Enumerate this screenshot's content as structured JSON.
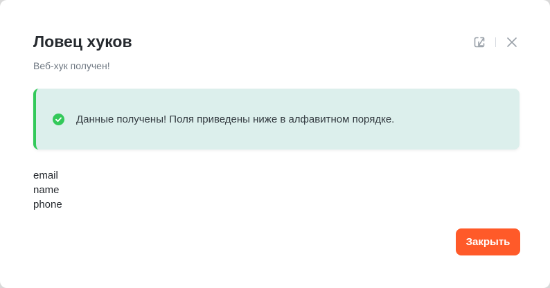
{
  "modal": {
    "title": "Ловец хуков",
    "subtitle": "Веб-хук получен!",
    "header_icons": [
      "open-external-icon",
      "close-icon"
    ]
  },
  "alert": {
    "icon": "check-circle-icon",
    "text": "Данные получены! Поля приведены ниже в алфавитном порядке.",
    "accent_color": "#33c95a",
    "background_color": "#dcefec"
  },
  "fields": [
    "email",
    "name",
    "phone"
  ],
  "footer": {
    "close_label": "Закрыть",
    "button_color": "#ff5a29"
  }
}
